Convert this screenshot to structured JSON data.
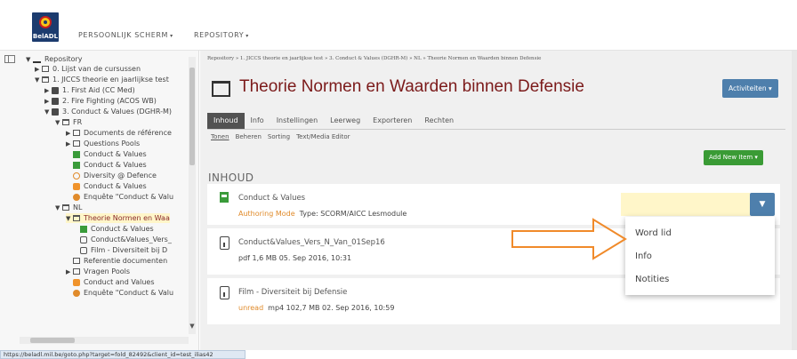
{
  "header": {
    "logo_text": "BelADL",
    "nav": [
      {
        "label": "PERSOONLIJK SCHERM"
      },
      {
        "label": "REPOSITORY"
      }
    ]
  },
  "tree": [
    {
      "label": "Repository",
      "icon": "repository-icon",
      "arrow": "▼"
    },
    {
      "label": "0. Lijst van de cursussen",
      "icon": "folder-icon",
      "arrow": "▶"
    },
    {
      "label": "1. JICCS theorie en jaarlijkse test",
      "icon": "folder-open-icon",
      "arrow": "▼"
    },
    {
      "label": "1. First Aid (CC Med)",
      "icon": "course-icon",
      "arrow": "▶"
    },
    {
      "label": "2. Fire Fighting (ACOS WB)",
      "icon": "course-icon",
      "arrow": "▶"
    },
    {
      "label": "3. Conduct & Values (DGHR-M)",
      "icon": "course-icon",
      "arrow": "▼"
    },
    {
      "label": "FR",
      "icon": "folder-open-icon",
      "arrow": "▼"
    },
    {
      "label": "Documents de référence",
      "icon": "folder-icon",
      "arrow": "▶"
    },
    {
      "label": "Questions Pools",
      "icon": "folder-icon",
      "arrow": "▶"
    },
    {
      "label": "Conduct & Values",
      "icon": "scorm-icon",
      "arrow": ""
    },
    {
      "label": "Conduct & Values",
      "icon": "scorm-icon",
      "arrow": ""
    },
    {
      "label": "Diversity @ Defence",
      "icon": "webinar-icon",
      "arrow": ""
    },
    {
      "label": "Conduct & Values",
      "icon": "test-icon",
      "arrow": ""
    },
    {
      "label": "Enquête \"Conduct & Valu",
      "icon": "survey-icon",
      "arrow": ""
    },
    {
      "label": "NL",
      "icon": "folder-open-icon",
      "arrow": "▼"
    },
    {
      "label": "Theorie Normen en Waa",
      "icon": "folder-open-icon",
      "arrow": "▼",
      "current": true
    },
    {
      "label": "Conduct & Values",
      "icon": "scorm-icon",
      "arrow": ""
    },
    {
      "label": "Conduct&Values_Vers_",
      "icon": "file-icon",
      "arrow": ""
    },
    {
      "label": "Film - Diversiteit bij D",
      "icon": "file-icon",
      "arrow": ""
    },
    {
      "label": "Referentie documenten",
      "icon": "folder-icon",
      "arrow": ""
    },
    {
      "label": "Vragen Pools",
      "icon": "folder-icon",
      "arrow": "▶"
    },
    {
      "label": "Conduct and Values",
      "icon": "test-icon",
      "arrow": ""
    },
    {
      "label": "Enquête \"Conduct & Valu",
      "icon": "survey-icon",
      "arrow": ""
    }
  ],
  "breadcrumb": "Repository  »  1. JICCS theorie en jaarlijkse test  »  3. Conduct & Values (DGHR-M)  »  NL  »  Theorie Normen en Waarden binnen Defensie",
  "page_title": "Theorie Normen en Waarden binnen Defensie",
  "activities_button": "Activiteiten ▾",
  "tabs": [
    {
      "label": "Inhoud",
      "active": true
    },
    {
      "label": "Info",
      "active": false
    },
    {
      "label": "Instellingen",
      "active": false
    },
    {
      "label": "Leerweg",
      "active": false
    },
    {
      "label": "Exporteren",
      "active": false
    },
    {
      "label": "Rechten",
      "active": false
    }
  ],
  "subtabs": [
    {
      "label": "Tonen",
      "active": true
    },
    {
      "label": "Beheren",
      "active": false
    },
    {
      "label": "Sorting",
      "active": false
    },
    {
      "label": "Text/Media Editor",
      "active": false
    }
  ],
  "add_button": "Add New Item ▾",
  "section_title": "INHOUD",
  "items": [
    {
      "name": "Conduct & Values",
      "status": "Authoring Mode",
      "props": "Type: SCORM/AICC Lesmodule",
      "icon": "scorm-icon"
    },
    {
      "name": "Conduct&Values_Vers_N_Van_01Sep16",
      "status": "",
      "props": "pdf   1,6 MB   05. Sep 2016, 10:31",
      "icon": "file-download-icon"
    },
    {
      "name": "Film - Diversiteit bij Defensie",
      "status": "unread",
      "props": "mp4   102,7 MB   02. Sep 2016, 10:59",
      "icon": "file-download-icon"
    }
  ],
  "dropdown_menu": [
    {
      "label": "Word lid"
    },
    {
      "label": "Info"
    },
    {
      "label": "Notities"
    }
  ],
  "status_bar": "https://beladl.mil.be/goto.php?target=fold_82492&client_id=test_ilias42",
  "colors": {
    "brand": "#7b1a1a",
    "button_blue": "#4e7fac",
    "button_green": "#3a9b35",
    "annotation_arrow": "#f08a2a"
  }
}
